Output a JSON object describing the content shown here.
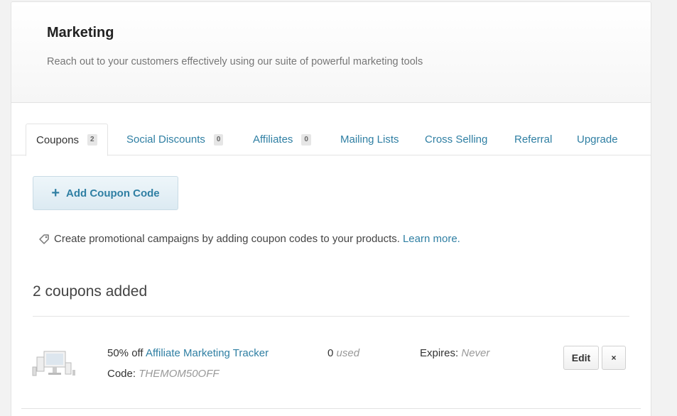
{
  "header": {
    "title": "Marketing",
    "subtitle": "Reach out to your customers effectively using our suite of powerful marketing tools"
  },
  "tabs": [
    {
      "label": "Coupons",
      "badge": "2",
      "active": true
    },
    {
      "label": "Social Discounts",
      "badge": "0"
    },
    {
      "label": "Affiliates",
      "badge": "0"
    },
    {
      "label": "Mailing Lists"
    },
    {
      "label": "Cross Selling"
    },
    {
      "label": "Referral"
    },
    {
      "label": "Upgrade"
    }
  ],
  "actions": {
    "add_coupon_label": "Add Coupon Code"
  },
  "promo": {
    "text": "Create promotional campaigns by adding coupon codes to your products.",
    "link": "Learn more."
  },
  "coupons_summary": "2 coupons added",
  "coupon": {
    "discount": "50% off",
    "product": "Affiliate Marketing Tracker",
    "code_label": "Code:",
    "code": "THEMOM50OFF",
    "used_count": "0",
    "used_label": "used",
    "expires_label": "Expires:",
    "expires_value": "Never",
    "edit_label": "Edit",
    "delete_label": "×"
  },
  "icons": {
    "tag": "tag-icon",
    "plus": "plus-icon",
    "product_thumb": "product-thumbnail"
  },
  "colors": {
    "link": "#2f7fa3",
    "button_bg": "#dceaf2",
    "page_bg": "#f2f2f2"
  }
}
